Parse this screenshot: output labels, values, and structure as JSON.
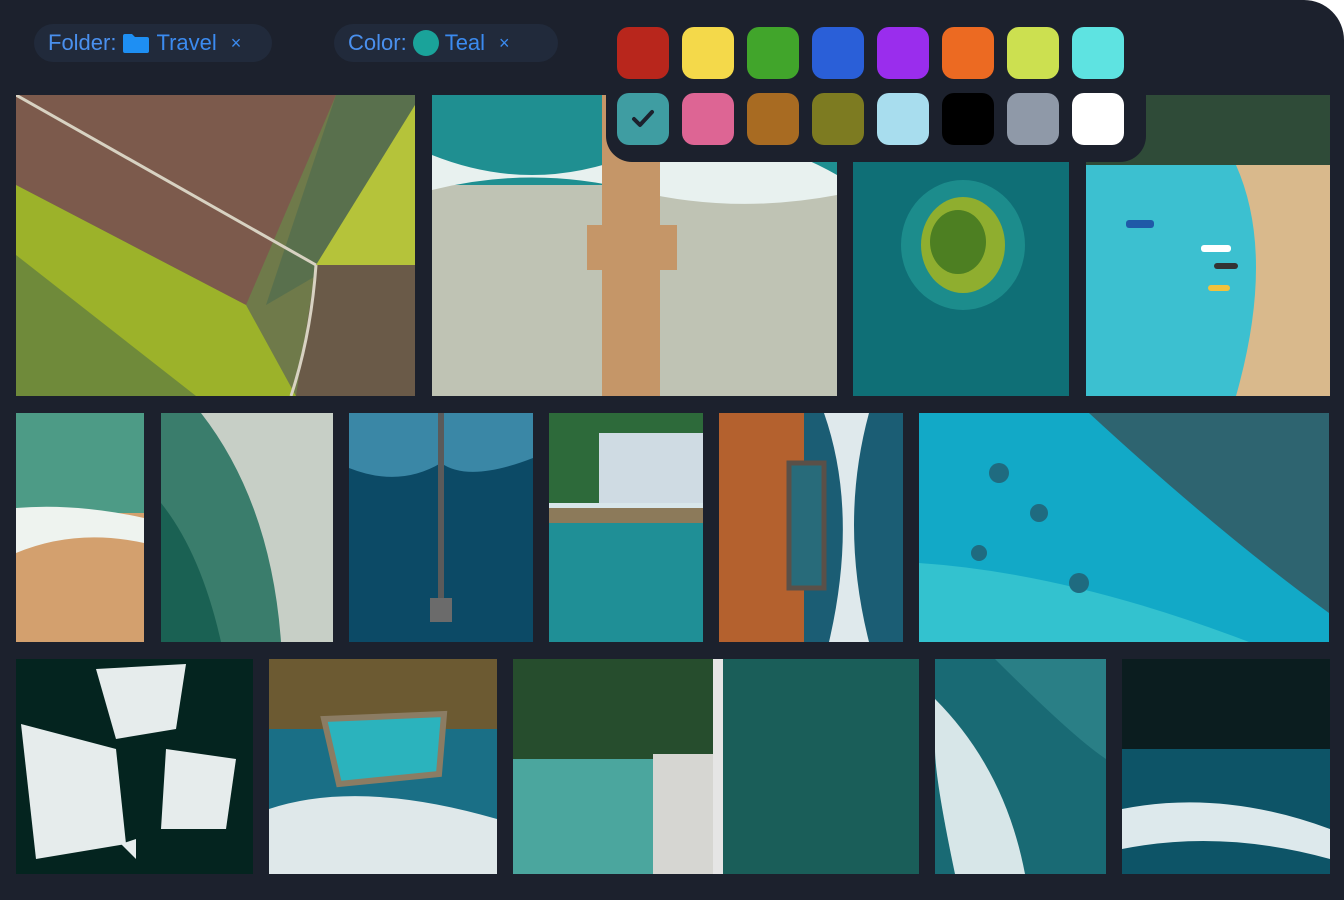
{
  "filters": {
    "folder": {
      "label": "Folder:",
      "value": "Travel",
      "close": "×"
    },
    "color": {
      "label": "Color:",
      "value": "Teal",
      "close": "×",
      "dot_color": "#1aa39a"
    }
  },
  "palette": {
    "row1": [
      "#b8261c",
      "#f4d94a",
      "#41a52b",
      "#2a5fd8",
      "#9a2ded",
      "#ec6a22",
      "#cce050",
      "#5ee3e1"
    ],
    "row2": [
      "#3f9da2",
      "#dd6594",
      "#a86b22",
      "#7d7b21",
      "#a8ddee",
      "#000000",
      "#8f99a8",
      "#ffffff"
    ],
    "selected_color": "#3f9da2"
  },
  "photos": [
    {
      "name": "farm-fields",
      "subject": "aerial farm fields"
    },
    {
      "name": "beach-pier",
      "subject": "aerial pier on beach"
    },
    {
      "name": "island",
      "subject": "small tree island"
    },
    {
      "name": "lagoon-boats",
      "subject": "lagoon with boats"
    },
    {
      "name": "wave-sand",
      "subject": "wave on sand"
    },
    {
      "name": "river-delta",
      "subject": "river delta"
    },
    {
      "name": "long-pier",
      "subject": "long pier in deep water"
    },
    {
      "name": "infinity-pool",
      "subject": "infinity pool"
    },
    {
      "name": "rock-pool",
      "subject": "rock pool coast"
    },
    {
      "name": "reef",
      "subject": "reef shallows"
    },
    {
      "name": "icebergs",
      "subject": "icebergs"
    },
    {
      "name": "ocean-pool",
      "subject": "ocean pool"
    },
    {
      "name": "dam",
      "subject": "dam and forest"
    },
    {
      "name": "dark-water",
      "subject": "dark teal water"
    },
    {
      "name": "surf",
      "subject": "surf waves"
    },
    {
      "name": "night-surf",
      "subject": "dark surf"
    }
  ]
}
